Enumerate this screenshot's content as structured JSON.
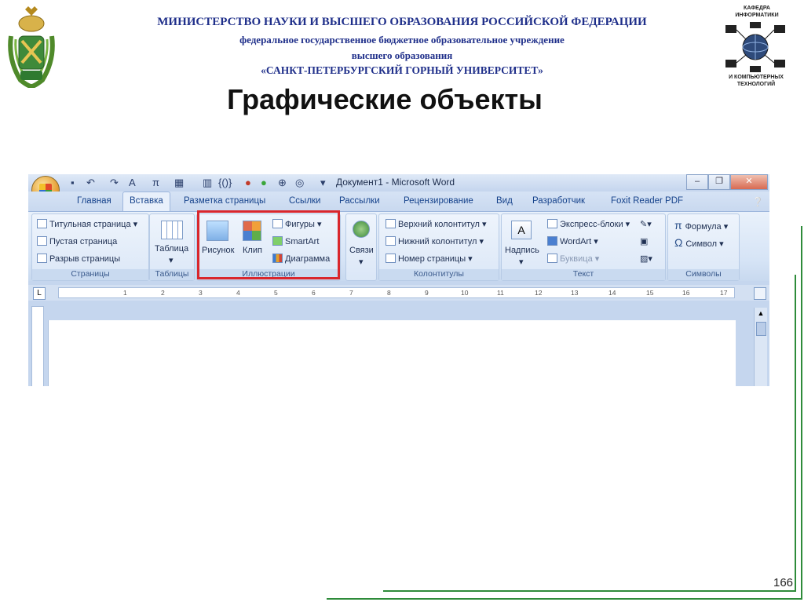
{
  "header": {
    "line1": "МИНИСТЕРСТВО НАУКИ И ВЫСШЕГО ОБРАЗОВАНИЯ РОССИЙСКОЙ ФЕДЕРАЦИИ",
    "line2": "федеральное государственное бюджетное образовательное учреждение",
    "line3": "высшего образования",
    "line4": "«САНКТ-ПЕТЕРБУРГСКИЙ ГОРНЫЙ УНИВЕРСИТЕТ»"
  },
  "logo_right": {
    "top": "КАФЕДРА ИНФОРМАТИКИ",
    "bottom": "И КОМПЬЮТЕРНЫХ ТЕХНОЛОГИЙ"
  },
  "slide": {
    "title": "Графические объекты",
    "page_number": "166"
  },
  "word": {
    "doc_title": "Документ1 - Microsoft Word",
    "tabs": [
      "Главная",
      "Вставка",
      "Разметка страницы",
      "Ссылки",
      "Рассылки",
      "Рецензирование",
      "Вид",
      "Разработчик",
      "Foxit Reader PDF"
    ],
    "active_tab": "Вставка",
    "groups": {
      "pages": {
        "label": "Страницы",
        "items": [
          "Титульная страница",
          "Пустая страница",
          "Разрыв страницы"
        ]
      },
      "tables": {
        "label": "Таблицы",
        "button": "Таблица"
      },
      "illustrations": {
        "label": "Иллюстрации",
        "picture": "Рисунок",
        "clip": "Клип",
        "shapes": "Фигуры",
        "smartart": "SmartArt",
        "chart": "Диаграмма"
      },
      "links": {
        "button": "Связи"
      },
      "header_footer": {
        "label": "Колонтитулы",
        "items": [
          "Верхний колонтитул",
          "Нижний колонтитул",
          "Номер страницы"
        ]
      },
      "text": {
        "label": "Текст",
        "textbox": "Надпись",
        "items": [
          "Экспресс-блоки",
          "WordArt",
          "Буквица"
        ]
      },
      "symbols": {
        "label": "Символы",
        "formula": "Формула",
        "symbol": "Символ"
      }
    },
    "ruler_numbers": [
      "1",
      "2",
      "3",
      "4",
      "5",
      "6",
      "7",
      "8",
      "9",
      "10",
      "11",
      "12",
      "13",
      "14",
      "15",
      "16",
      "17"
    ]
  },
  "colors": {
    "accent_red": "#d9262c",
    "header_blue": "#1f2f8a",
    "green_line": "#2e8b3a"
  }
}
